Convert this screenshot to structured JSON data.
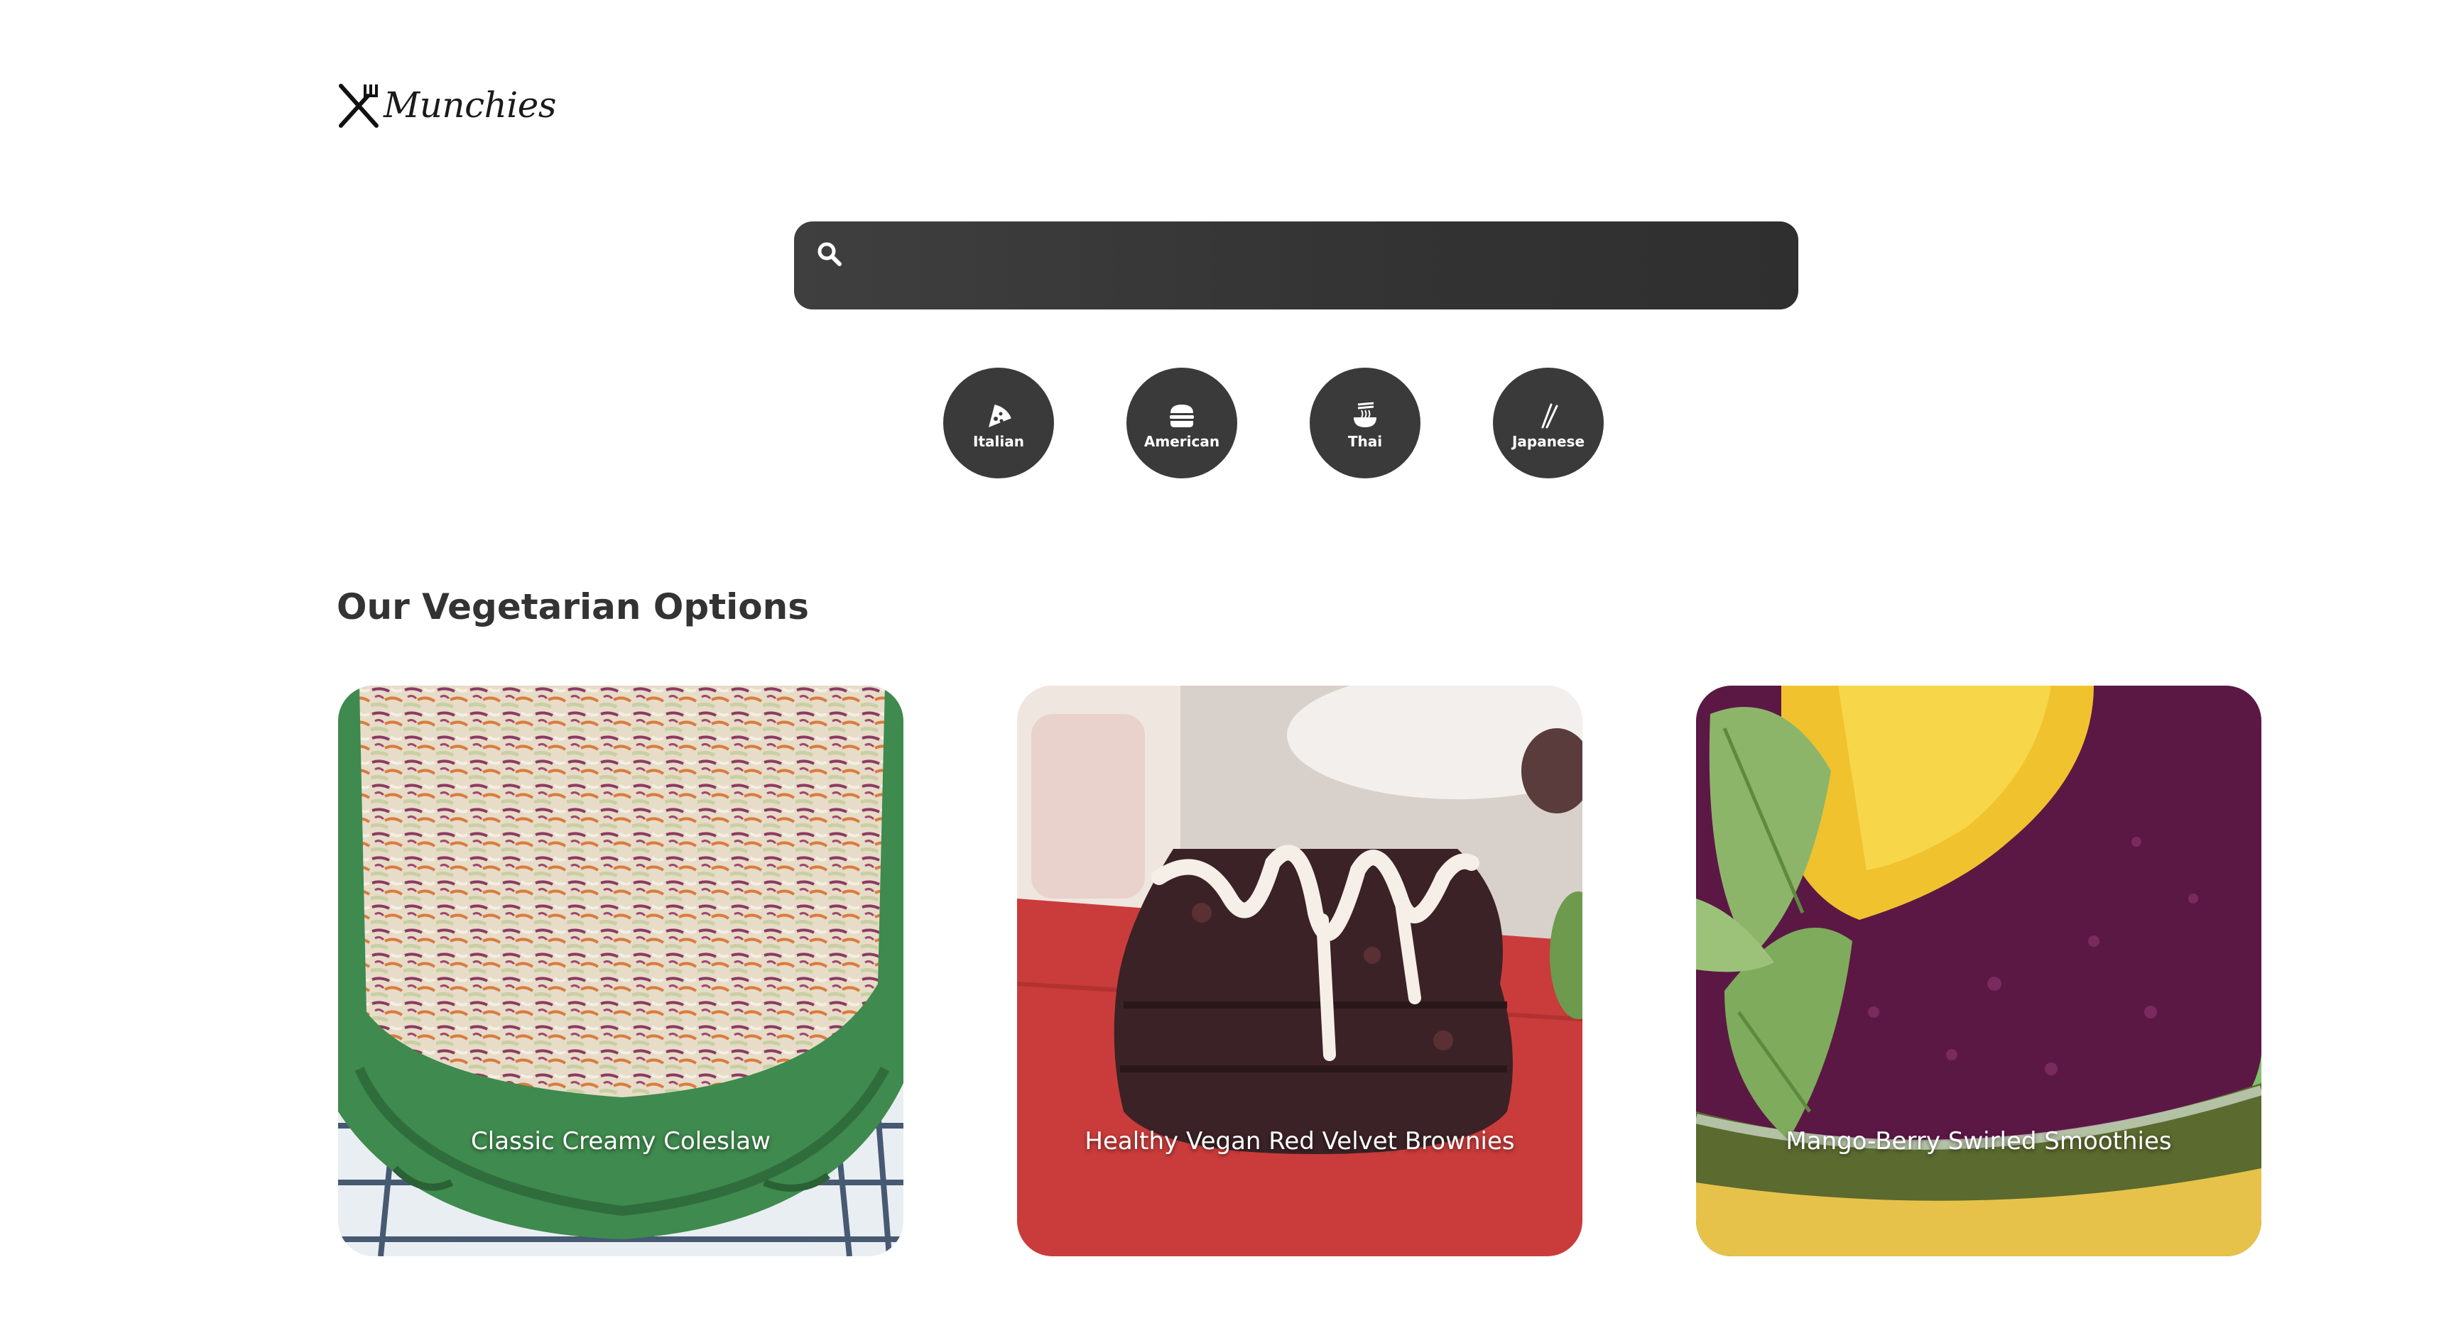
{
  "header": {
    "logo_text": "Munchies",
    "logo_icon": "fork-knife-icon"
  },
  "search": {
    "placeholder": "",
    "value": "",
    "icon": "search-icon"
  },
  "cuisines": [
    {
      "label": "Italian",
      "icon": "pizza-icon"
    },
    {
      "label": "American",
      "icon": "burger-icon"
    },
    {
      "label": "Thai",
      "icon": "noodle-bowl-icon"
    },
    {
      "label": "Japanese",
      "icon": "chopsticks-icon"
    }
  ],
  "section": {
    "title": "Our Vegetarian Options"
  },
  "recipes": [
    {
      "title": "Classic Creamy Coleslaw"
    },
    {
      "title": "Healthy Vegan Red Velvet Brownies"
    },
    {
      "title": "Mango-Berry Swirled Smoothies"
    }
  ],
  "colors": {
    "dark_ui": "#3a3a3a",
    "heading": "#333333",
    "background": "#ffffff"
  }
}
